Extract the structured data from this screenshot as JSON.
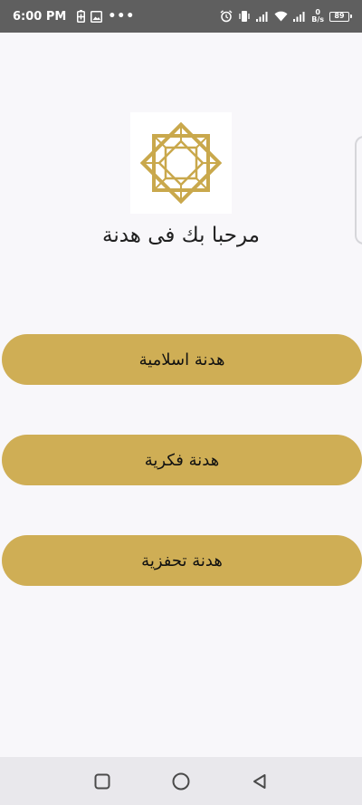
{
  "status_bar": {
    "time": "6:00 PM",
    "dots": "•••",
    "speed_value": "0",
    "speed_unit": "B/s",
    "battery_level": "89",
    "icons": [
      "battery-saver-icon",
      "image-icon",
      "alarm-icon",
      "vibrate-icon",
      "signal-icon",
      "wifi-icon",
      "signal-icon",
      "battery-icon"
    ]
  },
  "main": {
    "welcome_text": "مرحبا بك فى هدنة",
    "buttons": [
      {
        "label": "هدنة اسلامية"
      },
      {
        "label": "هدنة فكرية"
      },
      {
        "label": "هدنة تحفزية"
      }
    ]
  },
  "colors": {
    "accent": "#cfae55",
    "logo_gold": "#c9a84c",
    "background": "#f8f7fa",
    "status_bar": "#5f5f5f",
    "nav_bar": "#e9e8ec"
  },
  "nav_bar": {
    "icons": [
      "recent-apps-icon",
      "home-icon",
      "back-icon"
    ]
  }
}
